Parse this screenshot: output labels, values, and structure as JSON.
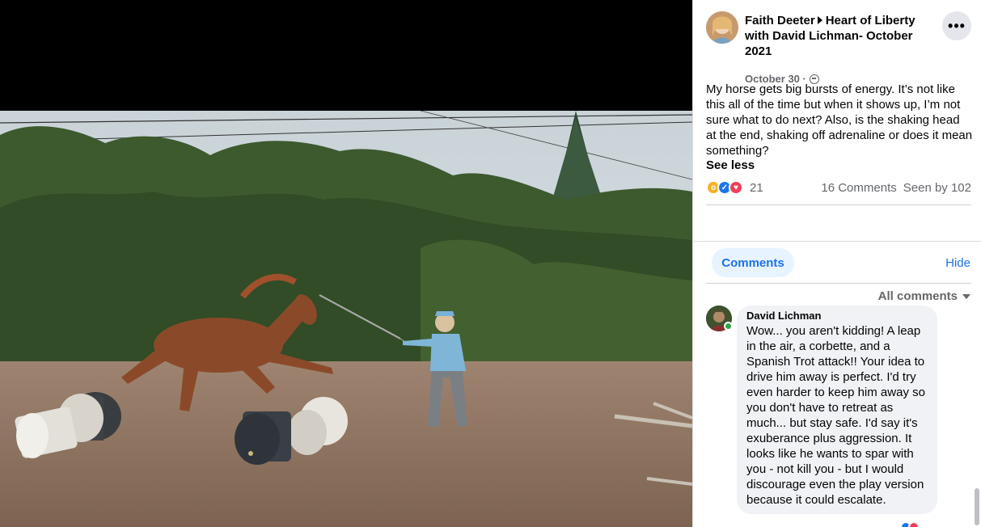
{
  "post": {
    "author": "Faith Deeter",
    "group": "Heart of Liberty with David Lichman- October 2021",
    "date": "October 30 ·",
    "body": "My horse gets big bursts of energy. It’s not like this all of the time but when it shows up, I’m not sure what to do next? Also, is the shaking head at the end, shaking off adrenaline or does it mean something?",
    "see_less": "See less",
    "reaction_count": "21",
    "comments_count": "16 Comments",
    "seen_by": "Seen by 102",
    "more_label": "•••"
  },
  "comments_section": {
    "tab_label": "Comments",
    "hide_label": "Hide",
    "filter_label": "All comments"
  },
  "comments": [
    {
      "author": "David Lichman",
      "text": "Wow... you aren't kidding! A leap in the air, a corbette, and a Spanish Trot attack!! Your idea to drive him away is perfect. I'd try even harder to keep him away so you don't have to retreat as much... but stay safe. I'd say it's exuberance plus aggression. It looks like he wants to spar with you - not kill you - but I would discourage even the play version because it could escalate."
    }
  ],
  "icons": {
    "reactions": [
      "wow-icon",
      "like-icon",
      "love-icon"
    ],
    "privacy": "globe-icon",
    "filter": "caret-down-icon"
  },
  "colors": {
    "link_blue": "#1b74e4",
    "tab_bg": "#e7f3ff",
    "bubble_bg": "#f0f2f5",
    "secondary_text": "#65676b"
  }
}
